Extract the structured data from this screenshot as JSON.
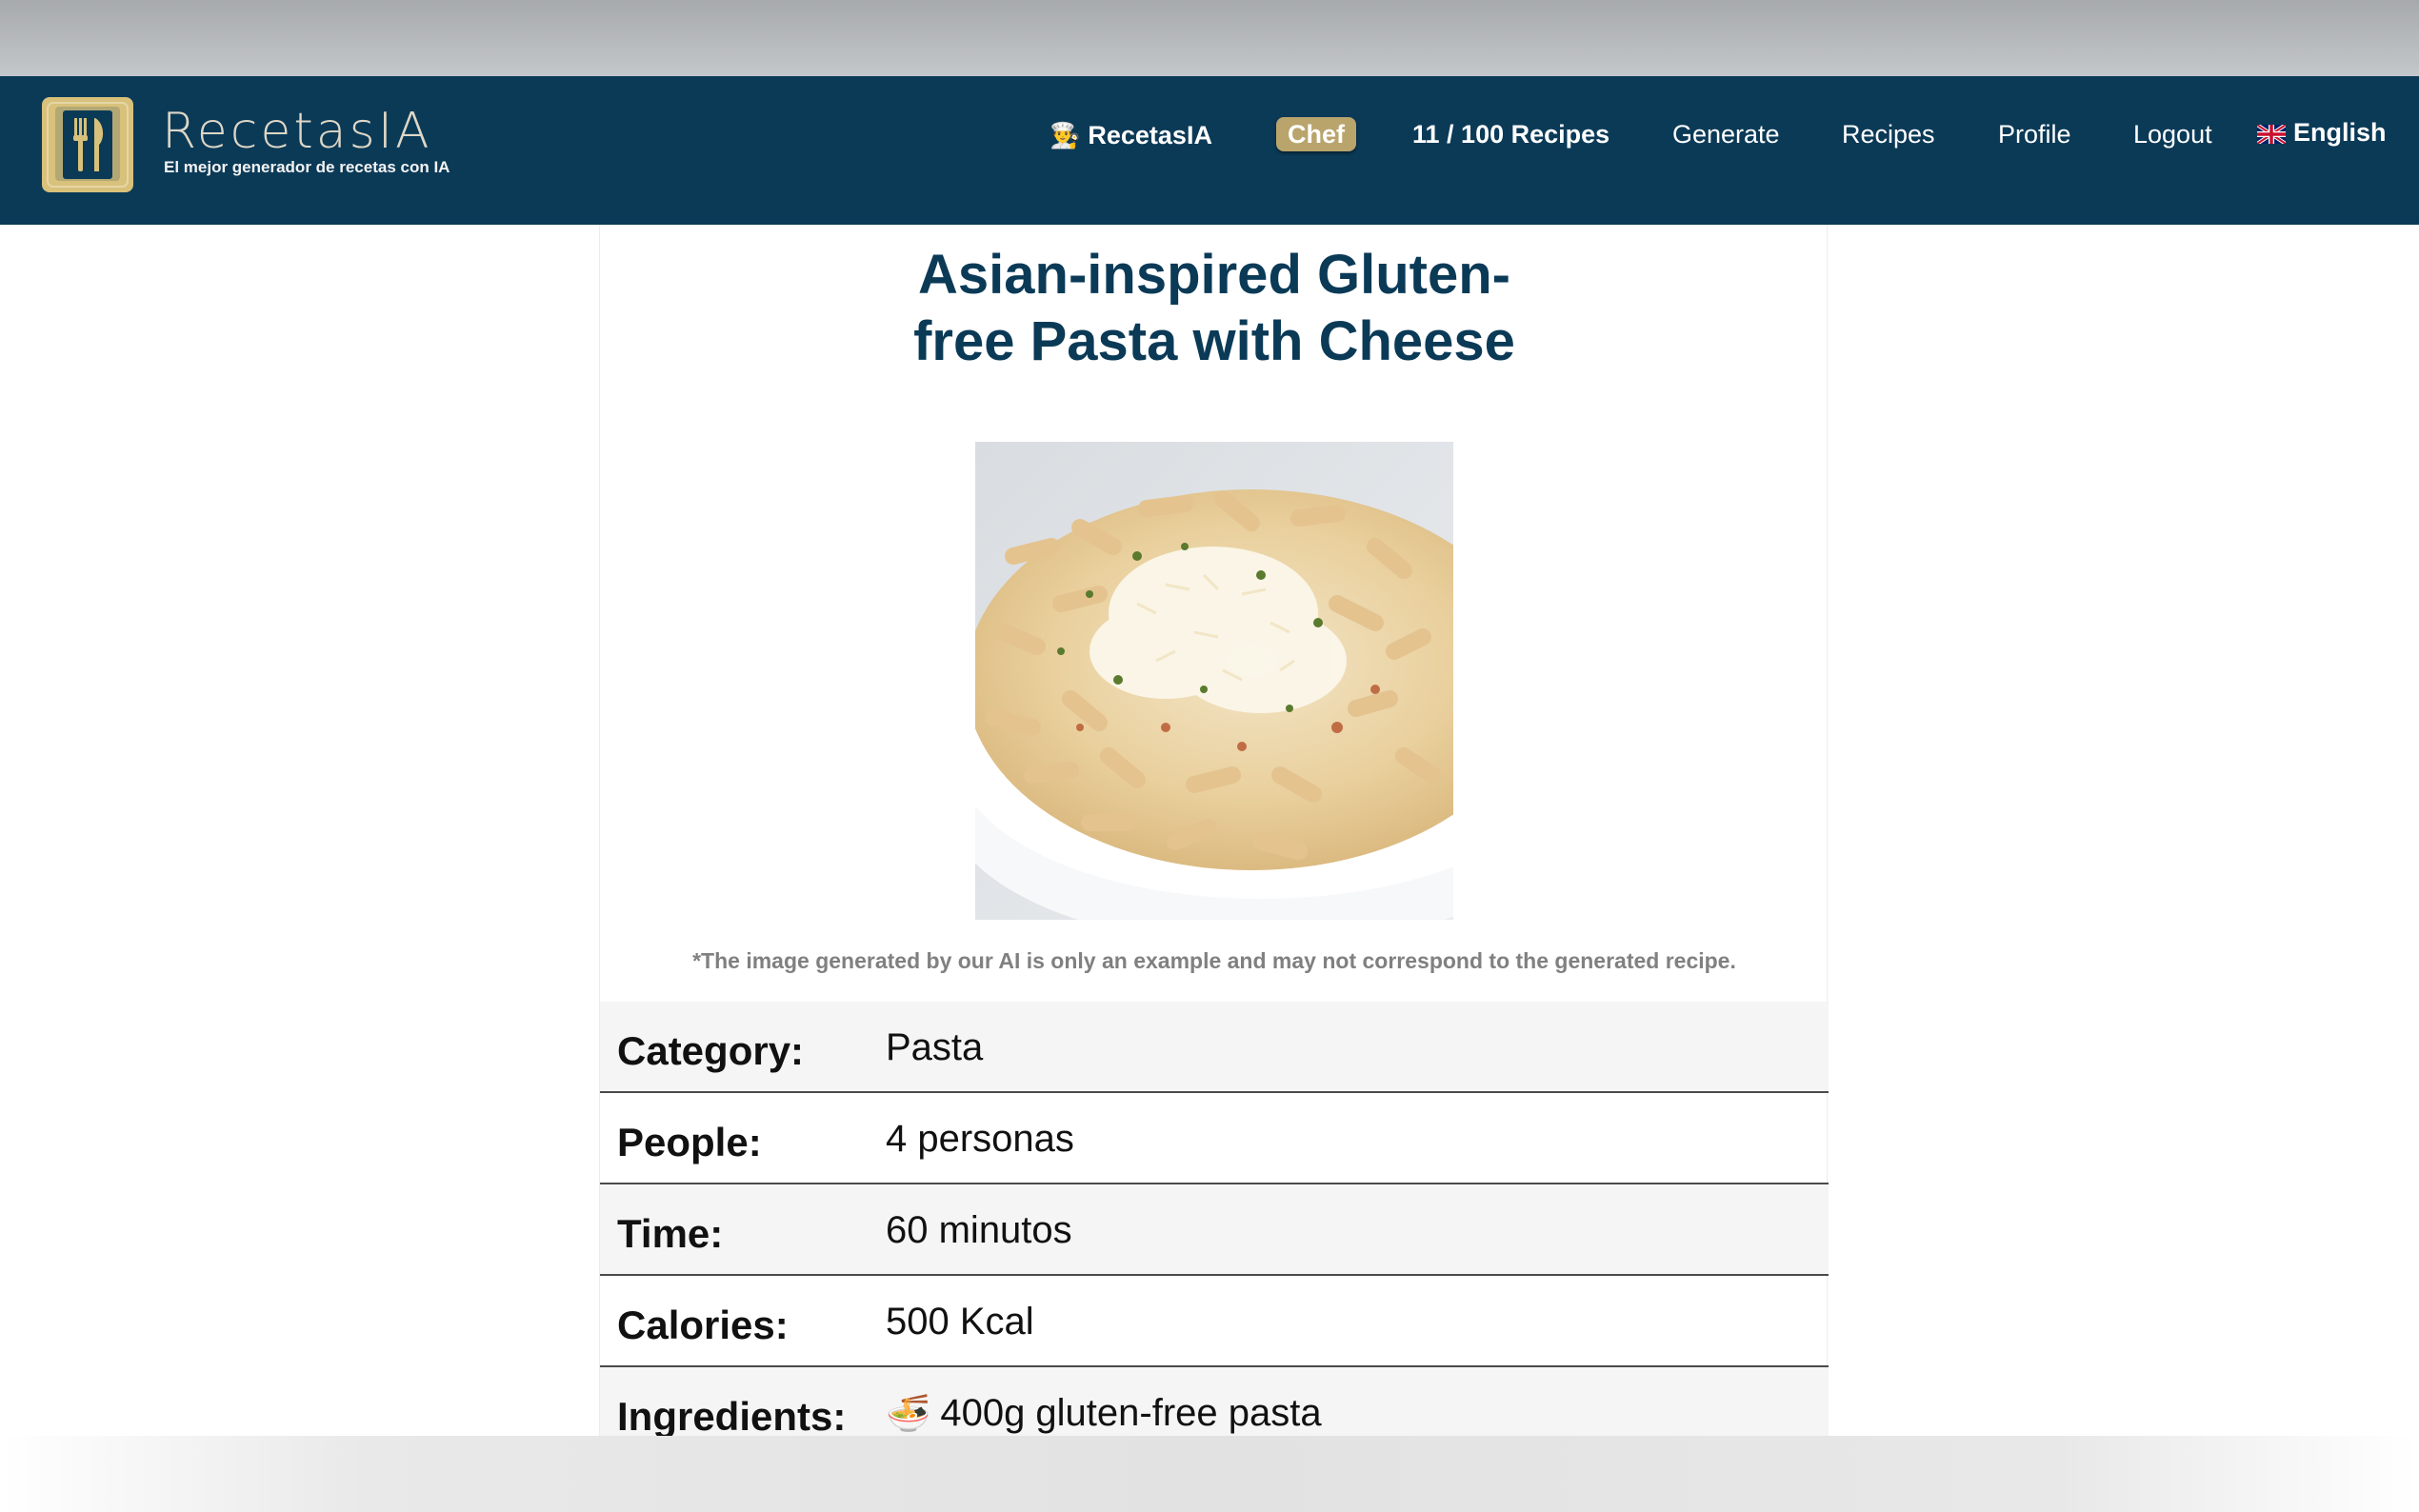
{
  "brand": {
    "name": "RecetasIA",
    "tagline": "El mejor generador de recetas con IA"
  },
  "nav": {
    "brand_label": "RecetasIA",
    "brand_emoji": "👨‍🍳",
    "badge": "Chef",
    "recipe_count": "11 / 100 Recipes",
    "generate": "Generate",
    "recipes": "Recipes",
    "profile": "Profile",
    "logout": "Logout",
    "language": "English"
  },
  "recipe": {
    "title_line1": "Asian-inspired Gluten-",
    "title_line2": "free Pasta with Cheese",
    "image_alt": "Gluten-free pasta with grated cheese in a white bowl",
    "disclaimer": "*The image generated by our AI is only an example and may not correspond to the generated recipe.",
    "details": [
      {
        "label": "Category:",
        "value": "Pasta"
      },
      {
        "label": "People:",
        "value": "4 personas"
      },
      {
        "label": "Time:",
        "value": "60 minutos"
      },
      {
        "label": "Calories:",
        "value": "500 Kcal"
      },
      {
        "label": "Ingredients:",
        "value": "400g gluten-free pasta",
        "emoji": "🍜"
      }
    ]
  },
  "colors": {
    "navbar": "#0b3a57",
    "accent_gold": "#d8c17a",
    "badge": "#b9a46c",
    "title": "#0b3a57"
  },
  "icons": {
    "logo": "fork-knife-book-icon",
    "language_flag": "uk-flag-icon"
  }
}
